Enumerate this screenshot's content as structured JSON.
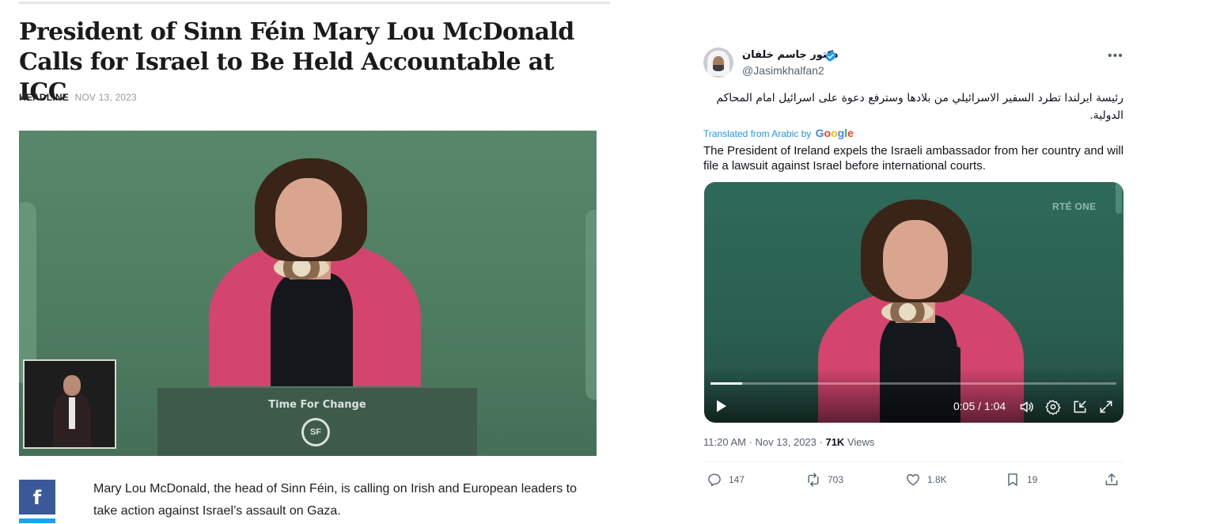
{
  "article": {
    "headline": "President of Sinn Féin Mary Lou McDonald Calls for Israel to Be Held Accountable at ICC",
    "category": "HEADLINE",
    "date": "NOV 13, 2023",
    "photo_podium_text": "Time For Change",
    "photo_podium_logo": "SF",
    "lede": "Mary Lou McDonald, the head of Sinn Féin, is calling on Irish and European leaders to take action against Israel’s assault on Gaza.",
    "share_icon": "facebook-icon",
    "share_label": "f"
  },
  "tweet": {
    "display_name": "دكتور جاسم خلفان",
    "handle": "@Jasimkhalfan2",
    "verified": true,
    "arabic_text": "رئيسة ايرلندا  تطرد السفير الاسرائيلي من بلادها وسترفع دعوة على اسرائيل امام المحاكم الدولية.",
    "translated_from": "Translated from Arabic by",
    "translator": "Google",
    "translation": "The President of Ireland expels the Israeli ambassador from her country and will file a lawsuit against Israel before international courts.",
    "video": {
      "watermark": "RTÉ ONE",
      "time": "0:05 / 1:04",
      "progress_fraction": 0.078
    },
    "posted_time": "11:20 AM",
    "posted_date": "Nov 13, 2023",
    "views_count": "71K",
    "views_label": "Views",
    "actions": {
      "replies": "147",
      "reposts": "703",
      "likes": "1.8K",
      "bookmarks": "19"
    },
    "colors": {
      "accent": "#1d9bf0",
      "muted": "#536471",
      "facebook": "#3b5998"
    }
  }
}
